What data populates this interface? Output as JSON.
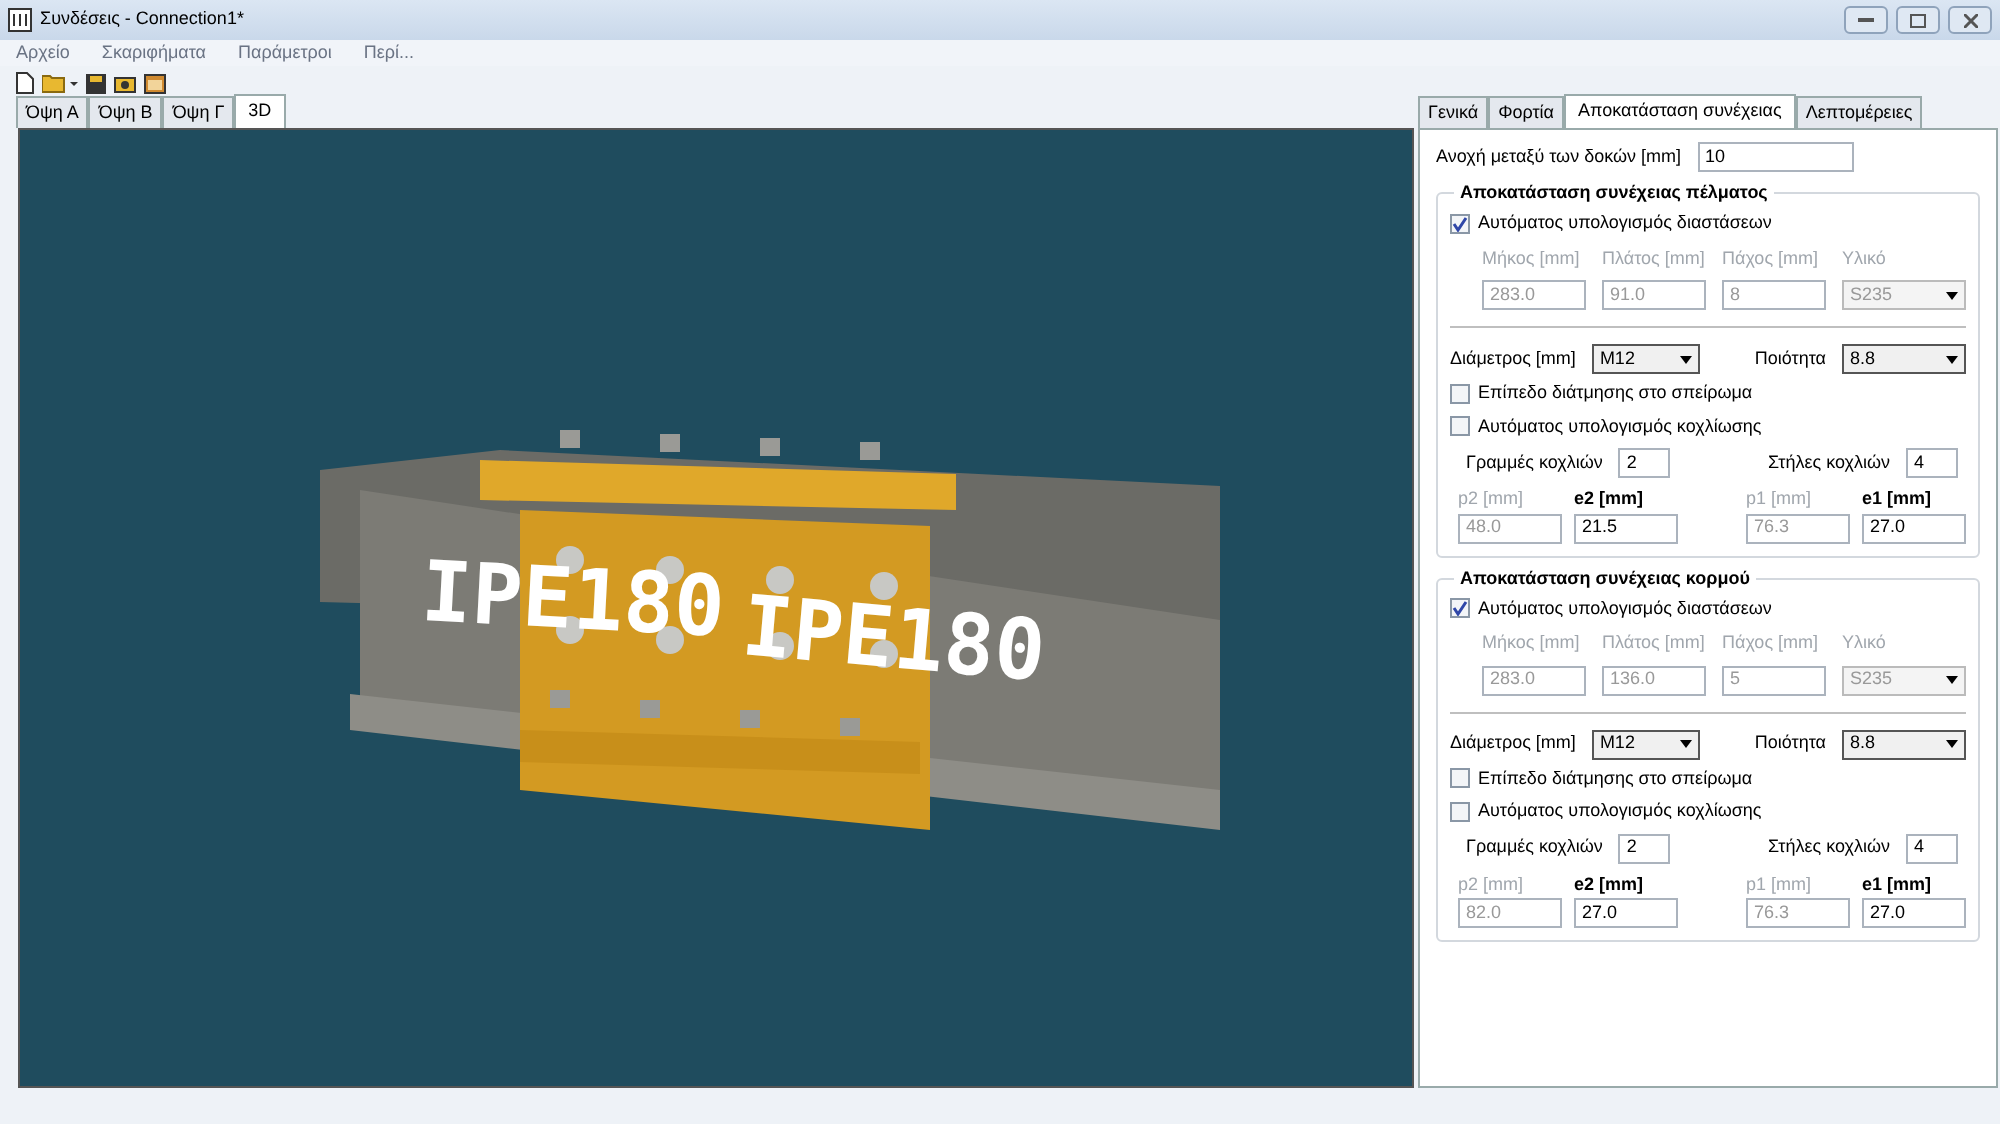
{
  "window": {
    "title": "Συνδέσεις - Connection1*"
  },
  "menu": [
    "Αρχείο",
    "Σκαριφήματα",
    "Παράμετροι",
    "Περί..."
  ],
  "view_tabs": [
    {
      "label": "Όψη Α",
      "selected": false
    },
    {
      "label": "Όψη Β",
      "selected": false
    },
    {
      "label": "Όψη Γ",
      "selected": false
    },
    {
      "label": "3D",
      "selected": true
    }
  ],
  "viewport": {
    "labels": [
      "IPE180",
      "IPE180"
    ]
  },
  "panel_tabs": [
    {
      "label": "Γενικά",
      "selected": false
    },
    {
      "label": "Φορτία",
      "selected": false
    },
    {
      "label": "Αποκατάσταση συνέχειας",
      "selected": true
    },
    {
      "label": "Λεπτομέρειες",
      "selected": false
    }
  ],
  "gap": {
    "label": "Ανοχή μεταξύ των δοκών [mm]",
    "value": "10"
  },
  "sections": [
    {
      "title": "Αποκατάσταση συνέχειας πέλματος",
      "auto_dims": {
        "label": "Αυτόματος υπολογισμός διαστάσεων",
        "checked": true
      },
      "dims": [
        {
          "label": "Μήκος [mm]",
          "value": "283.0",
          "kind": "input",
          "disabled": true
        },
        {
          "label": "Πλάτος [mm]",
          "value": "91.0",
          "kind": "input",
          "disabled": true
        },
        {
          "label": "Πάχος [mm]",
          "value": "8",
          "kind": "input",
          "disabled": true
        },
        {
          "label": "Υλικό",
          "value": "S235",
          "kind": "select",
          "disabled": true
        }
      ],
      "diameter": {
        "label": "Διάμετρος [mm]",
        "value": "M12"
      },
      "quality": {
        "label": "Ποιότητα",
        "value": "8.8"
      },
      "options": [
        {
          "label": "Επίπεδο διάτμησης στο σπείρωμα",
          "checked": false
        },
        {
          "label": "Αυτόματος υπολογισμός κοχλίωσης",
          "checked": false
        }
      ],
      "bolt_rows": {
        "label": "Γραμμές κοχλιών",
        "value": "2"
      },
      "bolt_cols": {
        "label": "Στήλες κοχλιών",
        "value": "4"
      },
      "spacing": [
        {
          "label": "p2 [mm]",
          "value": "48.0",
          "disabled": true
        },
        {
          "label": "e2 [mm]",
          "value": "21.5",
          "disabled": false
        },
        {
          "label": "p1 [mm]",
          "value": "76.3",
          "disabled": true
        },
        {
          "label": "e1 [mm]",
          "value": "27.0",
          "disabled": false
        }
      ]
    },
    {
      "title": "Αποκατάσταση συνέχειας κορμού",
      "auto_dims": {
        "label": "Αυτόματος υπολογισμός διαστάσεων",
        "checked": true
      },
      "dims": [
        {
          "label": "Μήκος [mm]",
          "value": "283.0",
          "kind": "input",
          "disabled": true
        },
        {
          "label": "Πλάτος [mm]",
          "value": "136.0",
          "kind": "input",
          "disabled": true
        },
        {
          "label": "Πάχος [mm]",
          "value": "5",
          "kind": "input",
          "disabled": true
        },
        {
          "label": "Υλικό",
          "value": "S235",
          "kind": "select",
          "disabled": true
        }
      ],
      "diameter": {
        "label": "Διάμετρος [mm]",
        "value": "M12"
      },
      "quality": {
        "label": "Ποιότητα",
        "value": "8.8"
      },
      "options": [
        {
          "label": "Επίπεδο διάτμησης στο σπείρωμα",
          "checked": false
        },
        {
          "label": "Αυτόματος υπολογισμός κοχλίωσης",
          "checked": false
        }
      ],
      "bolt_rows": {
        "label": "Γραμμές κοχλιών",
        "value": "2"
      },
      "bolt_cols": {
        "label": "Στήλες κοχλιών",
        "value": "4"
      },
      "spacing": [
        {
          "label": "p2 [mm]",
          "value": "82.0",
          "disabled": true
        },
        {
          "label": "e2 [mm]",
          "value": "27.0",
          "disabled": false
        },
        {
          "label": "p1 [mm]",
          "value": "76.3",
          "disabled": true
        },
        {
          "label": "e1 [mm]",
          "value": "27.0",
          "disabled": false
        }
      ]
    }
  ]
}
